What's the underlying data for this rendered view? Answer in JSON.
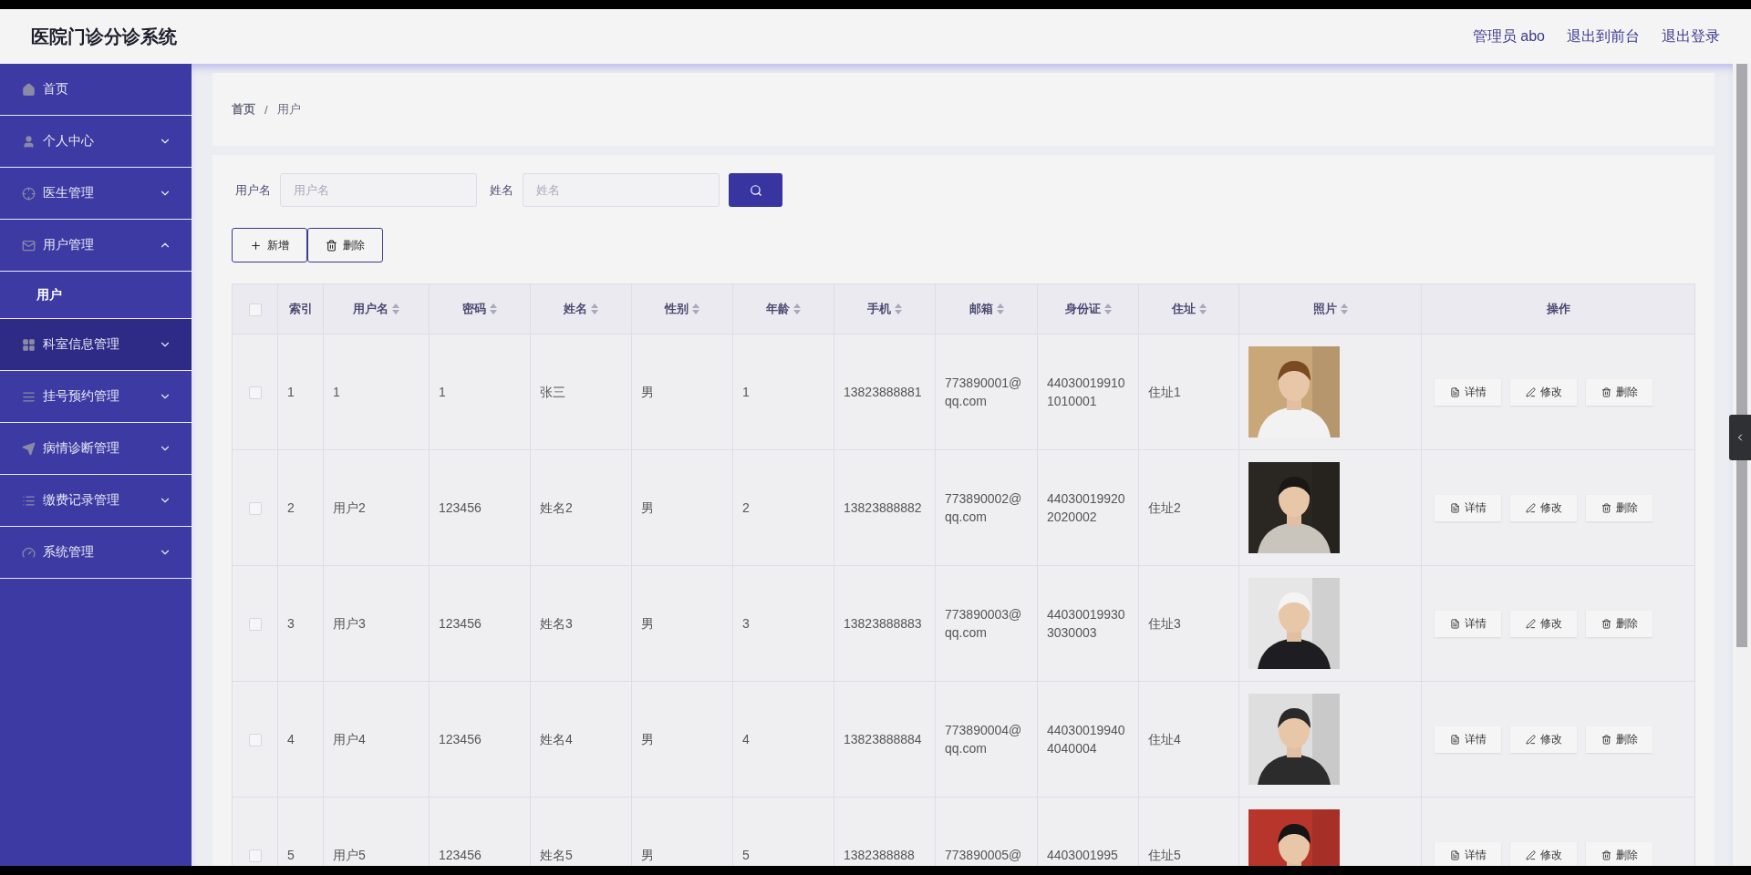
{
  "header": {
    "title": "医院门诊分诊系统",
    "links": [
      "管理员 abo",
      "退出到前台",
      "退出登录"
    ]
  },
  "sidebar": {
    "items": [
      {
        "label": "首页",
        "kind": "link",
        "active": false
      },
      {
        "label": "个人中心",
        "kind": "group",
        "expanded": false,
        "active": false
      },
      {
        "label": "医生管理",
        "kind": "group",
        "expanded": false,
        "active": false
      },
      {
        "label": "用户管理",
        "kind": "group",
        "expanded": true,
        "active": false,
        "children": [
          {
            "label": "用户",
            "selected": true
          }
        ]
      },
      {
        "label": "科室信息管理",
        "kind": "group",
        "expanded": false,
        "active": true
      },
      {
        "label": "挂号预约管理",
        "kind": "group",
        "expanded": false,
        "active": false
      },
      {
        "label": "病情诊断管理",
        "kind": "group",
        "expanded": false,
        "active": false
      },
      {
        "label": "缴费记录管理",
        "kind": "group",
        "expanded": false,
        "active": false
      },
      {
        "label": "系统管理",
        "kind": "group",
        "expanded": false,
        "active": false
      }
    ]
  },
  "breadcrumb": {
    "items": [
      "首页",
      "用户"
    ],
    "separator": "/"
  },
  "search": {
    "fields": [
      {
        "label": "用户名",
        "placeholder": "用户名"
      },
      {
        "label": "姓名",
        "placeholder": "姓名"
      }
    ]
  },
  "toolbar": {
    "buttons": [
      {
        "label": "新增",
        "kind": "add"
      },
      {
        "label": "删除",
        "kind": "delete"
      }
    ]
  },
  "table": {
    "header_checked": false,
    "columns": [
      {
        "label": "索引",
        "sortable": false
      },
      {
        "label": "用户名",
        "sortable": true
      },
      {
        "label": "密码",
        "sortable": true
      },
      {
        "label": "姓名",
        "sortable": true
      },
      {
        "label": "性别",
        "sortable": true
      },
      {
        "label": "年龄",
        "sortable": true
      },
      {
        "label": "手机",
        "sortable": true
      },
      {
        "label": "邮箱",
        "sortable": true
      },
      {
        "label": "身份证",
        "sortable": true
      },
      {
        "label": "住址",
        "sortable": true
      },
      {
        "label": "照片",
        "sortable": true
      },
      {
        "label": "操作",
        "sortable": false
      }
    ],
    "rows": [
      {
        "checked": false,
        "cells": [
          "1",
          "1",
          "1",
          "张三",
          "男",
          "1",
          "13823888881",
          "773890001@qq.com",
          "440300199101010001",
          "住址1"
        ],
        "actions": [
          "详情",
          "修改",
          "删除"
        ]
      },
      {
        "checked": false,
        "cells": [
          "2",
          "用户2",
          "123456",
          "姓名2",
          "男",
          "2",
          "13823888882",
          "773890002@qq.com",
          "440300199202020002",
          "住址2"
        ],
        "actions": [
          "详情",
          "修改",
          "删除"
        ]
      },
      {
        "checked": false,
        "cells": [
          "3",
          "用户3",
          "123456",
          "姓名3",
          "男",
          "3",
          "13823888883",
          "773890003@qq.com",
          "440300199303030003",
          "住址3"
        ],
        "actions": [
          "详情",
          "修改",
          "删除"
        ]
      },
      {
        "checked": false,
        "cells": [
          "4",
          "用户4",
          "123456",
          "姓名4",
          "男",
          "4",
          "13823888884",
          "773890004@qq.com",
          "440300199404040004",
          "住址4"
        ],
        "actions": [
          "详情",
          "修改",
          "删除"
        ]
      },
      {
        "checked": false,
        "cells": [
          "5",
          "用户5",
          "123456",
          "姓名5",
          "男",
          "5",
          "1382388888",
          "773890005@",
          "4403001995",
          "住址5"
        ],
        "actions": [
          "详情",
          "修改",
          "删除"
        ]
      }
    ]
  }
}
